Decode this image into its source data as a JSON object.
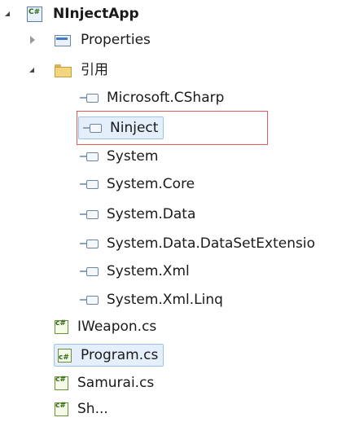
{
  "tree": {
    "project": "NInjectApp",
    "properties": "Properties",
    "references_folder": "引用",
    "references": [
      "Microsoft.CSharp",
      "Ninject",
      "System",
      "System.Core",
      "System.Data",
      "System.Data.DataSetExtensio",
      "System.Xml",
      "System.Xml.Linq"
    ],
    "files": [
      "IWeapon.cs",
      "Program.cs",
      "Samurai.cs",
      "Sh..."
    ]
  }
}
